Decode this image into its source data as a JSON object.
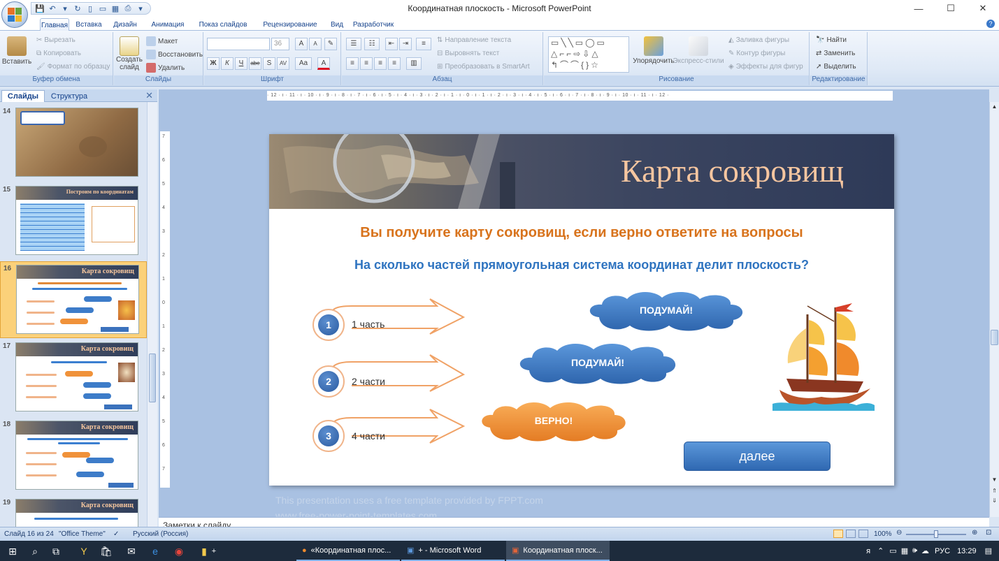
{
  "window": {
    "title": "Координатная плоскость - Microsoft PowerPoint",
    "minimize": "—",
    "maximize": "☐",
    "close": "✕"
  },
  "ribbon_tabs": [
    "Главная",
    "Вставка",
    "Дизайн",
    "Анимация",
    "Показ слайдов",
    "Рецензирование",
    "Вид",
    "Разработчик"
  ],
  "ribbon": {
    "clipboard": {
      "paste": "Вставить",
      "cut": "Вырезать",
      "copy": "Копировать",
      "format_painter": "Формат по образцу",
      "label": "Буфер обмена"
    },
    "slides": {
      "layout": "Макет",
      "reset": "Восстановить",
      "new_slide_1": "Создать",
      "new_slide_2": "слайд",
      "delete": "Удалить",
      "label": "Слайды"
    },
    "font": {
      "size": "36",
      "bold": "Ж",
      "italic": "К",
      "underline": "Ч",
      "strike": "abe",
      "shadow": "S",
      "spacing": "AV",
      "case": "Aa",
      "color": "A",
      "grow": "A",
      "shrink": "A",
      "label": "Шрифт"
    },
    "paragraph": {
      "direction": "Направление текста",
      "align_text": "Выровнять текст",
      "smartart": "Преобразовать в SmartArt",
      "label": "Абзац"
    },
    "drawing": {
      "arrange": "Упорядочить",
      "quick_styles": "Экспресс-стили",
      "fill": "Заливка фигуры",
      "outline": "Контур фигуры",
      "effects": "Эффекты для фигур",
      "label": "Рисование"
    },
    "editing": {
      "find": "Найти",
      "replace": "Заменить",
      "select": "Выделить",
      "label": "Редактирование"
    }
  },
  "pane": {
    "tab_slides": "Слайды",
    "tab_outline": "Структура",
    "close": "✕",
    "thumbnails": [
      {
        "num": "14",
        "title": ""
      },
      {
        "num": "15",
        "title": "Построим по координатам"
      },
      {
        "num": "16",
        "title": "Карта сокровищ"
      },
      {
        "num": "17",
        "title": "Карта сокровищ"
      },
      {
        "num": "18",
        "title": "Карта сокровищ"
      },
      {
        "num": "19",
        "title": "Карта сокровищ"
      }
    ]
  },
  "ruler": {
    "horizontal": "· 12 · ı · 11 · ı · 10 · ı · 9 · ı · 8 · ı · 7 · ı · 6 · ı · 5 · ı · 4 · ı · 3 · ı · 2 · ı · 1 · ı · 0 · ı · 1 · ı · 2 · ı · 3 · ı · 4 · ı · 5 · ı · 6 · ı · 7 · ı · 8 · ı · 9 · ı · 10 · ı · 11 · ı · 12 ·",
    "vertical": [
      "7",
      "6",
      "5",
      "4",
      "3",
      "2",
      "1",
      "0",
      "1",
      "2",
      "3",
      "4",
      "5",
      "6",
      "7"
    ]
  },
  "slide": {
    "title": "Карта сокровищ",
    "subtitle": "Вы получите карту сокровищ, если верно ответите на вопросы",
    "question": "На сколько частей прямоугольная система координат делит плоскость?",
    "answers": [
      {
        "num": "1",
        "text": "1 часть"
      },
      {
        "num": "2",
        "text": "2 части"
      },
      {
        "num": "3",
        "text": "4 части"
      }
    ],
    "clouds": [
      {
        "text": "ПОДУМАЙ!",
        "color": "#3d7cc9"
      },
      {
        "text": "ПОДУМАЙ!",
        "color": "#3d7cc9"
      },
      {
        "text": "ВЕРНО!",
        "color": "#f0923a"
      }
    ],
    "next_button": "далее"
  },
  "template_note": "This presentation uses a free template provided by FPPT.com",
  "template_note2": "www.free-power-point-templates.com",
  "notes_placeholder": "Заметки к слайду",
  "status": {
    "slide_of": "Слайд 16 из 24",
    "theme": "\"Office Theme\"",
    "language": "Русский (Россия)",
    "zoom": "100%"
  },
  "taskbar": {
    "tasks": [
      "«Координатная плос...",
      "+ - Microsoft Word",
      "Координатная плоск..."
    ],
    "lang": "РУС",
    "time": "13:29"
  },
  "colors": {
    "accent_blue": "#2f74c0",
    "accent_orange": "#d8731c",
    "title_peach": "#f6c6a0"
  }
}
